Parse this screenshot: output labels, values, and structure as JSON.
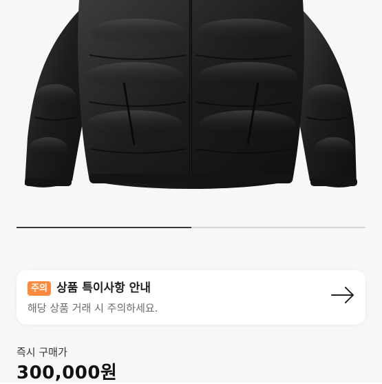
{
  "product": {
    "image_alt": "black puffer jacket",
    "gallery_progress": 0.5
  },
  "notice": {
    "badge": "주의",
    "title": "상품 특이사항 안내",
    "description": "해당 상품 거래 시 주의하세요.",
    "arrow_icon": "arrow-right-icon"
  },
  "purchase": {
    "label": "즉시 구매가",
    "price": "300,000원"
  },
  "colors": {
    "badge": "#ff8a3d",
    "progress": "#3a3a3a"
  }
}
